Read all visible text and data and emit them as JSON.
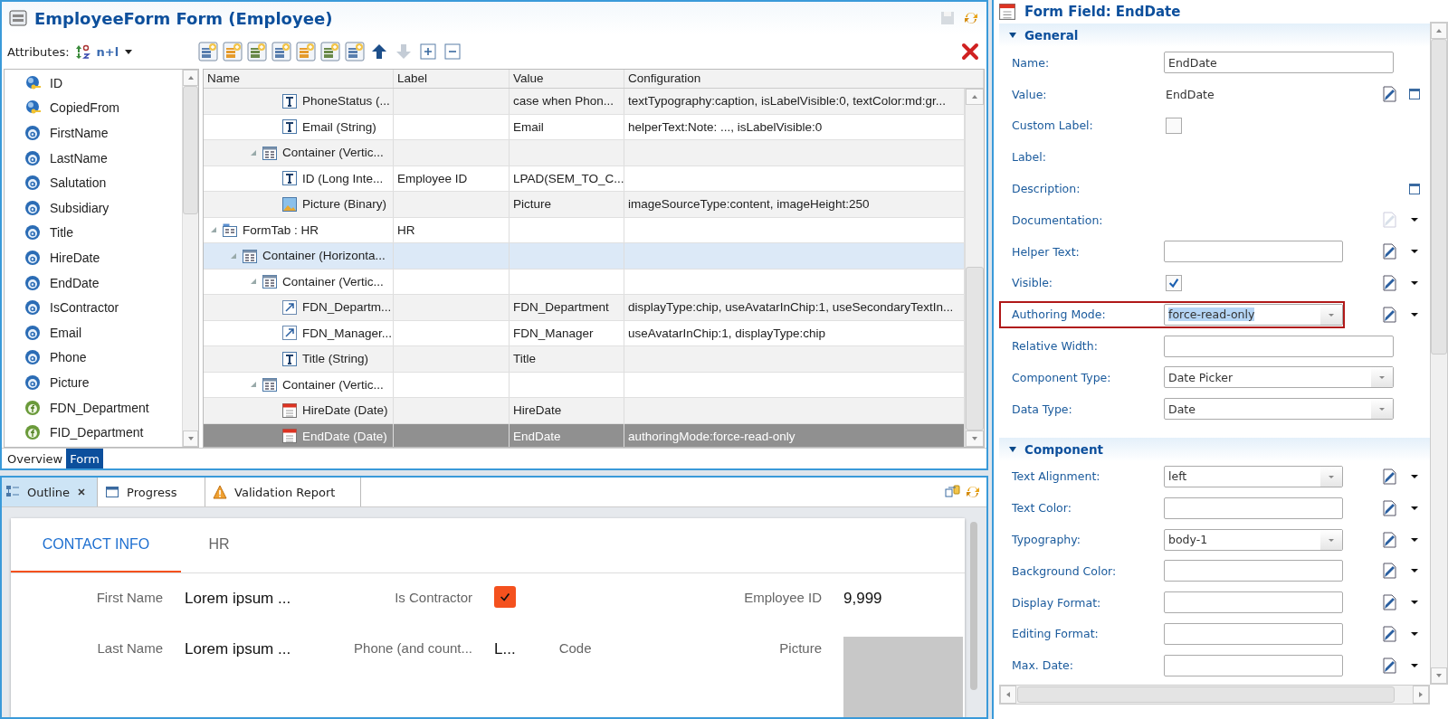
{
  "editor": {
    "title": "EmployeeForm Form (Employee)",
    "attributes_label": "Attributes:",
    "sort_label": "n+l",
    "toolbar": [
      {
        "kind": "add",
        "disabled": false
      },
      {
        "kind": "add",
        "disabled": false
      },
      {
        "kind": "add",
        "disabled": false
      },
      {
        "kind": "add",
        "disabled": false
      },
      {
        "kind": "add",
        "disabled": false
      },
      {
        "kind": "add",
        "disabled": false
      },
      {
        "kind": "add",
        "disabled": false
      },
      {
        "kind": "up",
        "disabled": false
      },
      {
        "kind": "down",
        "disabled": true
      },
      {
        "kind": "expand",
        "disabled": false
      },
      {
        "kind": "collapse",
        "disabled": false
      }
    ],
    "save_disabled": true,
    "attributes": [
      {
        "name": "ID",
        "kind": "key"
      },
      {
        "name": "CopiedFrom",
        "kind": "key"
      },
      {
        "name": "FirstName",
        "kind": "attribute"
      },
      {
        "name": "LastName",
        "kind": "attribute"
      },
      {
        "name": "Salutation",
        "kind": "attribute"
      },
      {
        "name": "Subsidiary",
        "kind": "attribute"
      },
      {
        "name": "Title",
        "kind": "attribute"
      },
      {
        "name": "HireDate",
        "kind": "attribute"
      },
      {
        "name": "EndDate",
        "kind": "attribute"
      },
      {
        "name": "IsContractor",
        "kind": "attribute"
      },
      {
        "name": "Email",
        "kind": "attribute"
      },
      {
        "name": "Phone",
        "kind": "attribute"
      },
      {
        "name": "Picture",
        "kind": "attribute"
      },
      {
        "name": "FDN_Department",
        "kind": "function"
      },
      {
        "name": "FID_Department",
        "kind": "function"
      }
    ],
    "columns": [
      "Name",
      "Label",
      "Value",
      "Configuration"
    ],
    "tree": [
      {
        "children": [
          {
            "children": [
              {
                "children": [
                  {
                    "name": "PhoneStatus (...",
                    "kind": "text",
                    "value": "case  when Phon...",
                    "configuration": "textTypography:caption, isLabelVisible:0, textColor:md:gr...",
                    "selected": false,
                    "highlighted": false
                  },
                  {
                    "name": "Email (String)",
                    "kind": "text",
                    "value": "Email",
                    "configuration": "helperText:Note: ..., isLabelVisible:0",
                    "selected": false,
                    "highlighted": false
                  }
                ]
              },
              {
                "name": "Container (Vertic...",
                "kind": "container",
                "expanded": true,
                "selected": false,
                "highlighted": false,
                "children": [
                  {
                    "name": "ID (Long Inte...",
                    "kind": "text",
                    "label": "Employee ID",
                    "value": "LPAD(SEM_TO_C...",
                    "selected": false,
                    "highlighted": false
                  },
                  {
                    "name": "Picture (Binary)",
                    "kind": "image",
                    "value": "Picture",
                    "configuration": "imageSourceType:content, imageHeight:250",
                    "selected": false,
                    "highlighted": false
                  }
                ]
              }
            ]
          }
        ]
      },
      {
        "name": "FormTab : HR",
        "kind": "tab",
        "expanded": true,
        "label": "HR",
        "selected": false,
        "highlighted": false,
        "children": [
          {
            "name": "Container (Horizonta...",
            "kind": "container",
            "expanded": true,
            "selected": false,
            "highlighted": true,
            "children": [
              {
                "name": "Container (Vertic...",
                "kind": "container",
                "expanded": true,
                "selected": false,
                "highlighted": false,
                "children": [
                  {
                    "name": "FDN_Departm...",
                    "kind": "link",
                    "value": "FDN_Department",
                    "configuration": "displayType:chip, useAvatarInChip:1, useSecondaryTextIn...",
                    "selected": false,
                    "highlighted": false
                  },
                  {
                    "name": "FDN_Manager...",
                    "kind": "link",
                    "value": "FDN_Manager",
                    "configuration": "useAvatarInChip:1, displayType:chip",
                    "selected": false,
                    "highlighted": false
                  },
                  {
                    "name": "Title (String)",
                    "kind": "text",
                    "value": "Title",
                    "selected": false,
                    "highlighted": false
                  }
                ]
              },
              {
                "name": "Container (Vertic...",
                "kind": "container",
                "expanded": true,
                "selected": false,
                "highlighted": false,
                "children": [
                  {
                    "name": "HireDate (Date)",
                    "kind": "date",
                    "value": "HireDate",
                    "selected": false,
                    "highlighted": false
                  },
                  {
                    "name": "EndDate (Date)",
                    "kind": "date",
                    "value": "EndDate",
                    "configuration": "authoringMode:force-read-only",
                    "selected": true,
                    "highlighted": false
                  }
                ]
              }
            ]
          }
        ]
      }
    ],
    "bottom_tabs": [
      {
        "label": "Overview",
        "selected": false
      },
      {
        "label": "Form",
        "selected": true
      }
    ]
  },
  "views": {
    "tabs": [
      {
        "label": "Outline",
        "kind": "outline",
        "selected": true,
        "closable": true
      },
      {
        "label": "Progress",
        "kind": "progress",
        "selected": false,
        "closable": false
      },
      {
        "label": "Validation Report",
        "kind": "warning",
        "selected": false,
        "closable": false
      }
    ]
  },
  "preview": {
    "tabs": [
      {
        "label": "CONTACT INFO",
        "selected": true
      },
      {
        "label": "HR",
        "selected": false
      }
    ],
    "rows": [
      [
        {
          "label": "First Name",
          "kind": "text",
          "value": "Lorem ipsum ..."
        },
        {
          "label": "Is Contractor",
          "kind": "checkbox",
          "checked": true
        },
        {
          "label": "Employee ID",
          "kind": "text",
          "value": "9,999"
        }
      ],
      [
        {
          "label": "Last Name",
          "kind": "text",
          "value": "Lorem ipsum ..."
        },
        {
          "label": "Phone (and count...",
          "kind": "text",
          "value": "L...",
          "extra_label": "Code"
        },
        {
          "label": "Picture",
          "kind": "image"
        }
      ]
    ]
  },
  "properties": {
    "title": "Form Field: EndDate",
    "sections": [
      {
        "title": "General",
        "expanded": true,
        "fields": [
          {
            "label": "Name:",
            "kind": "input",
            "value": "EndDate",
            "highlighted": false
          },
          {
            "label": "Value:",
            "kind": "text",
            "value": "EndDate",
            "tools": [
              {
                "kind": "edit",
                "disabled": false
              },
              {
                "kind": "window"
              }
            ],
            "highlighted": false
          },
          {
            "label": "Custom Label:",
            "kind": "checkbox",
            "checked": false,
            "highlighted": false
          },
          {
            "label": "Label:",
            "kind": "none",
            "highlighted": false
          },
          {
            "label": "Description:",
            "kind": "none",
            "tools": [
              {
                "kind": "blank"
              },
              {
                "kind": "window"
              }
            ],
            "highlighted": false
          },
          {
            "label": "Documentation:",
            "kind": "none",
            "tools": [
              {
                "kind": "edit",
                "disabled": true
              },
              {
                "kind": "caret"
              }
            ],
            "highlighted": false
          },
          {
            "label": "Helper Text:",
            "kind": "input",
            "tools": [
              {
                "kind": "edit",
                "disabled": false
              },
              {
                "kind": "caret"
              }
            ],
            "highlighted": false
          },
          {
            "label": "Visible:",
            "kind": "checkbox",
            "checked": true,
            "tools": [
              {
                "kind": "edit",
                "disabled": false
              },
              {
                "kind": "caret"
              }
            ],
            "highlighted": false
          },
          {
            "label": "Authoring Mode:",
            "kind": "select",
            "value": "force-read-only",
            "value_selected": true,
            "tools": [
              {
                "kind": "edit",
                "disabled": false
              },
              {
                "kind": "caret"
              }
            ],
            "highlighted": true
          },
          {
            "label": "Relative Width:",
            "kind": "input",
            "highlighted": false
          },
          {
            "label": "Component Type:",
            "kind": "select",
            "value": "Date Picker",
            "value_selected": false,
            "highlighted": false
          },
          {
            "label": "Data Type:",
            "kind": "select",
            "value": "Date",
            "value_selected": false,
            "highlighted": false
          }
        ]
      },
      {
        "title": "Component",
        "expanded": true,
        "fields": [
          {
            "label": "Text Alignment:",
            "kind": "select",
            "value": "left",
            "value_selected": false,
            "tools": [
              {
                "kind": "edit",
                "disabled": false
              },
              {
                "kind": "caret"
              }
            ],
            "highlighted": false
          },
          {
            "label": "Text Color:",
            "kind": "input",
            "tools": [
              {
                "kind": "edit",
                "disabled": false
              },
              {
                "kind": "caret"
              }
            ],
            "highlighted": false
          },
          {
            "label": "Typography:",
            "kind": "select",
            "value": "body-1",
            "value_selected": false,
            "tools": [
              {
                "kind": "edit",
                "disabled": false
              },
              {
                "kind": "caret"
              }
            ],
            "highlighted": false
          },
          {
            "label": "Background Color:",
            "kind": "input",
            "tools": [
              {
                "kind": "edit",
                "disabled": false
              },
              {
                "kind": "caret"
              }
            ],
            "highlighted": false
          },
          {
            "label": "Display Format:",
            "kind": "input",
            "tools": [
              {
                "kind": "edit",
                "disabled": false
              },
              {
                "kind": "caret"
              }
            ],
            "highlighted": false
          },
          {
            "label": "Editing Format:",
            "kind": "input",
            "tools": [
              {
                "kind": "edit",
                "disabled": false
              },
              {
                "kind": "caret"
              }
            ],
            "highlighted": false
          },
          {
            "label": "Max. Date:",
            "kind": "input",
            "tools": [
              {
                "kind": "edit",
                "disabled": false
              },
              {
                "kind": "caret"
              }
            ],
            "highlighted": false
          }
        ]
      }
    ]
  }
}
